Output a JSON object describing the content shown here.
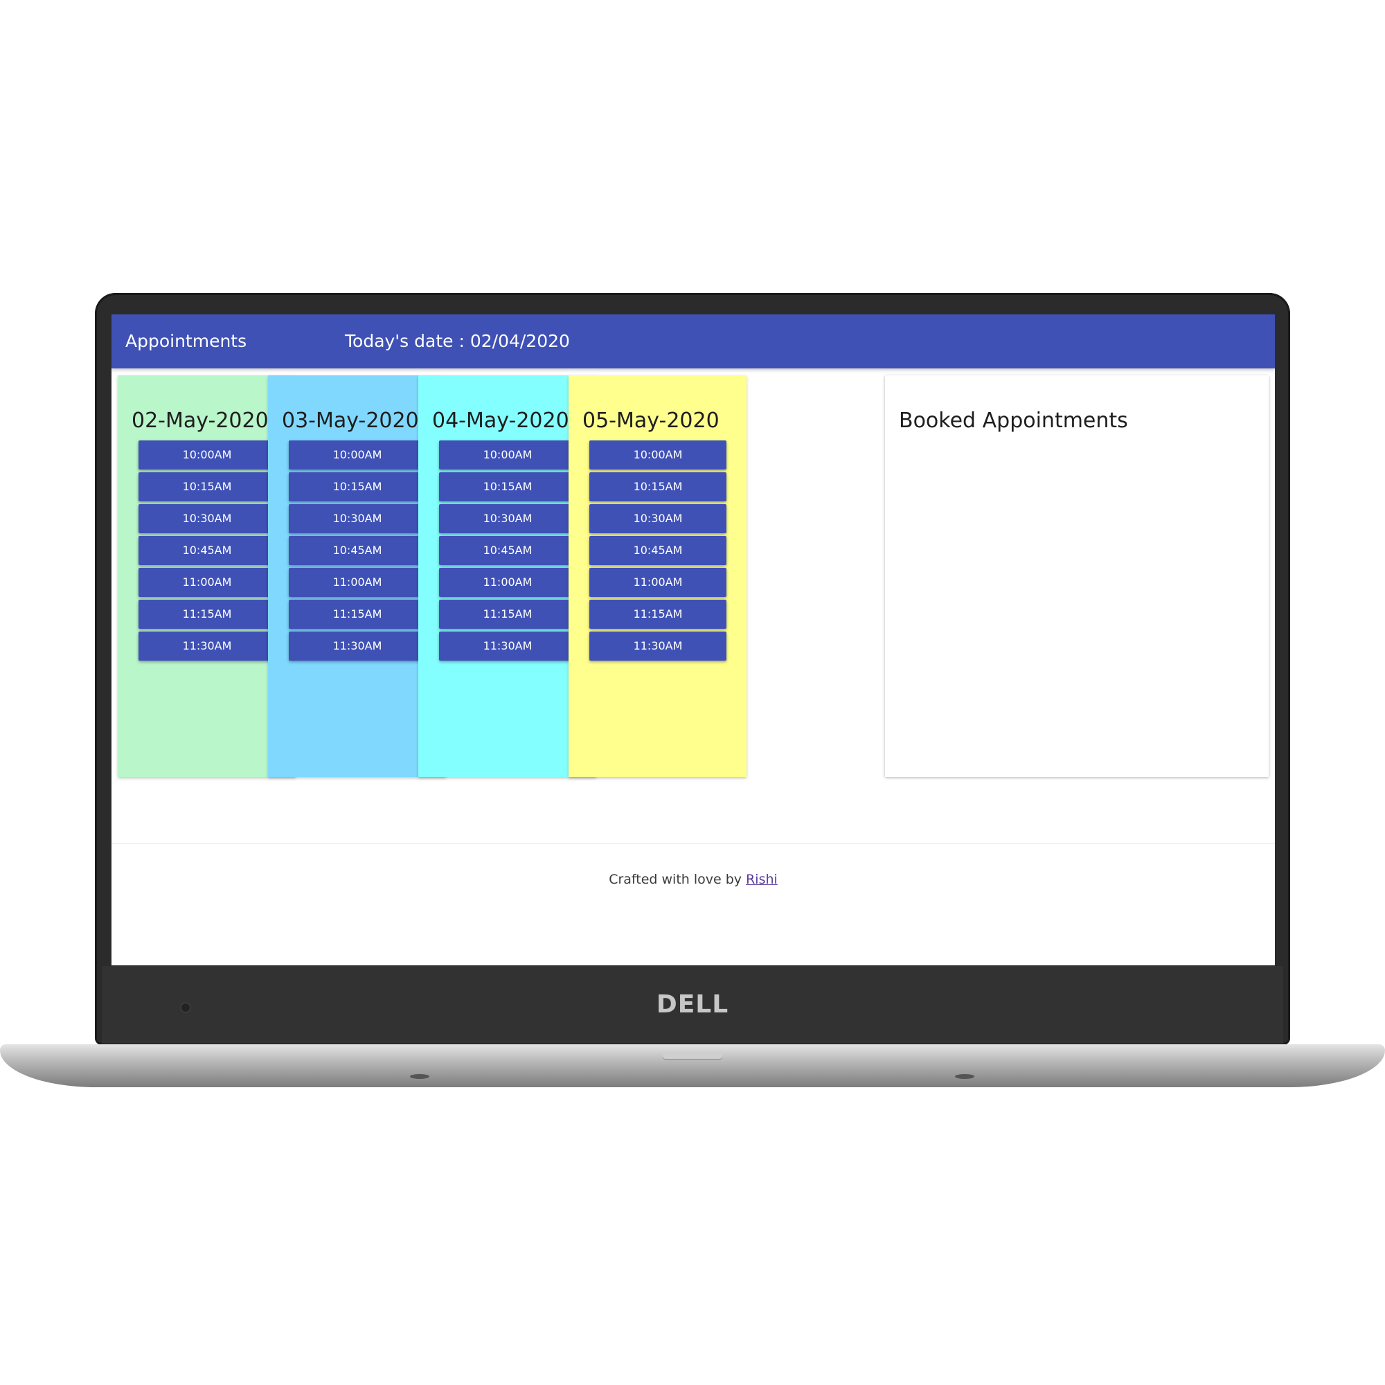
{
  "navbar": {
    "title": "Appointments",
    "date_text": "Today's date : 02/04/2020"
  },
  "days": [
    {
      "date": "02-May-2020",
      "color": "#b9f6ca",
      "slots": [
        "10:00AM",
        "10:15AM",
        "10:30AM",
        "10:45AM",
        "11:00AM",
        "11:15AM",
        "11:30AM"
      ]
    },
    {
      "date": "03-May-2020",
      "color": "#80d8ff",
      "slots": [
        "10:00AM",
        "10:15AM",
        "10:30AM",
        "10:45AM",
        "11:00AM",
        "11:15AM",
        "11:30AM"
      ]
    },
    {
      "date": "04-May-2020",
      "color": "#84ffff",
      "slots": [
        "10:00AM",
        "10:15AM",
        "10:30AM",
        "10:45AM",
        "11:00AM",
        "11:15AM",
        "11:30AM"
      ]
    },
    {
      "date": "05-May-2020",
      "color": "#ffff8d",
      "slots": [
        "10:00AM",
        "10:15AM",
        "10:30AM",
        "10:45AM",
        "11:00AM",
        "11:15AM",
        "11:30AM"
      ]
    }
  ],
  "booked": {
    "title": "Booked Appointments"
  },
  "footer": {
    "prefix": "Crafted with love by ",
    "author": "Rishi"
  },
  "device": {
    "brand": "DELL"
  },
  "colors": {
    "accent": "#3f51b5"
  }
}
